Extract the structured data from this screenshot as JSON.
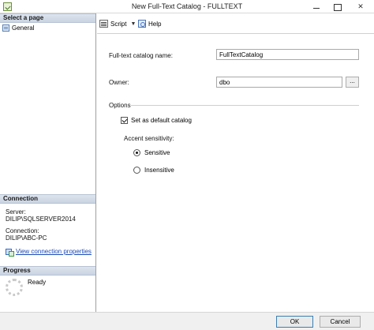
{
  "window": {
    "title": "New Full-Text Catalog - FULLTEXT"
  },
  "left_pane": {
    "select_page_header": "Select a page",
    "pages": [
      {
        "label": "General"
      }
    ],
    "connection_header": "Connection",
    "server_label": "Server:",
    "server_value": "DILIP\\SQLSERVER2014",
    "connection_label": "Connection:",
    "connection_value": "DILIP\\ABC-PC",
    "view_connection_link": "View connection properties",
    "progress_header": "Progress",
    "progress_status": "Ready"
  },
  "toolbar": {
    "script_label": "Script",
    "help_label": "Help"
  },
  "form": {
    "catalog_name_label": "Full-text catalog name:",
    "catalog_name_value": "FullTextCatalog",
    "owner_label": "Owner:",
    "owner_value": "dbo",
    "browse_label": "...",
    "options_label": "Options",
    "default_catalog_label": "Set as default catalog",
    "default_catalog_checked": true,
    "accent_label": "Accent sensitivity:",
    "sensitive_label": "Sensitive",
    "insensitive_label": "Insensitive",
    "selected_accent": "Sensitive"
  },
  "footer": {
    "ok_label": "OK",
    "cancel_label": "Cancel"
  }
}
